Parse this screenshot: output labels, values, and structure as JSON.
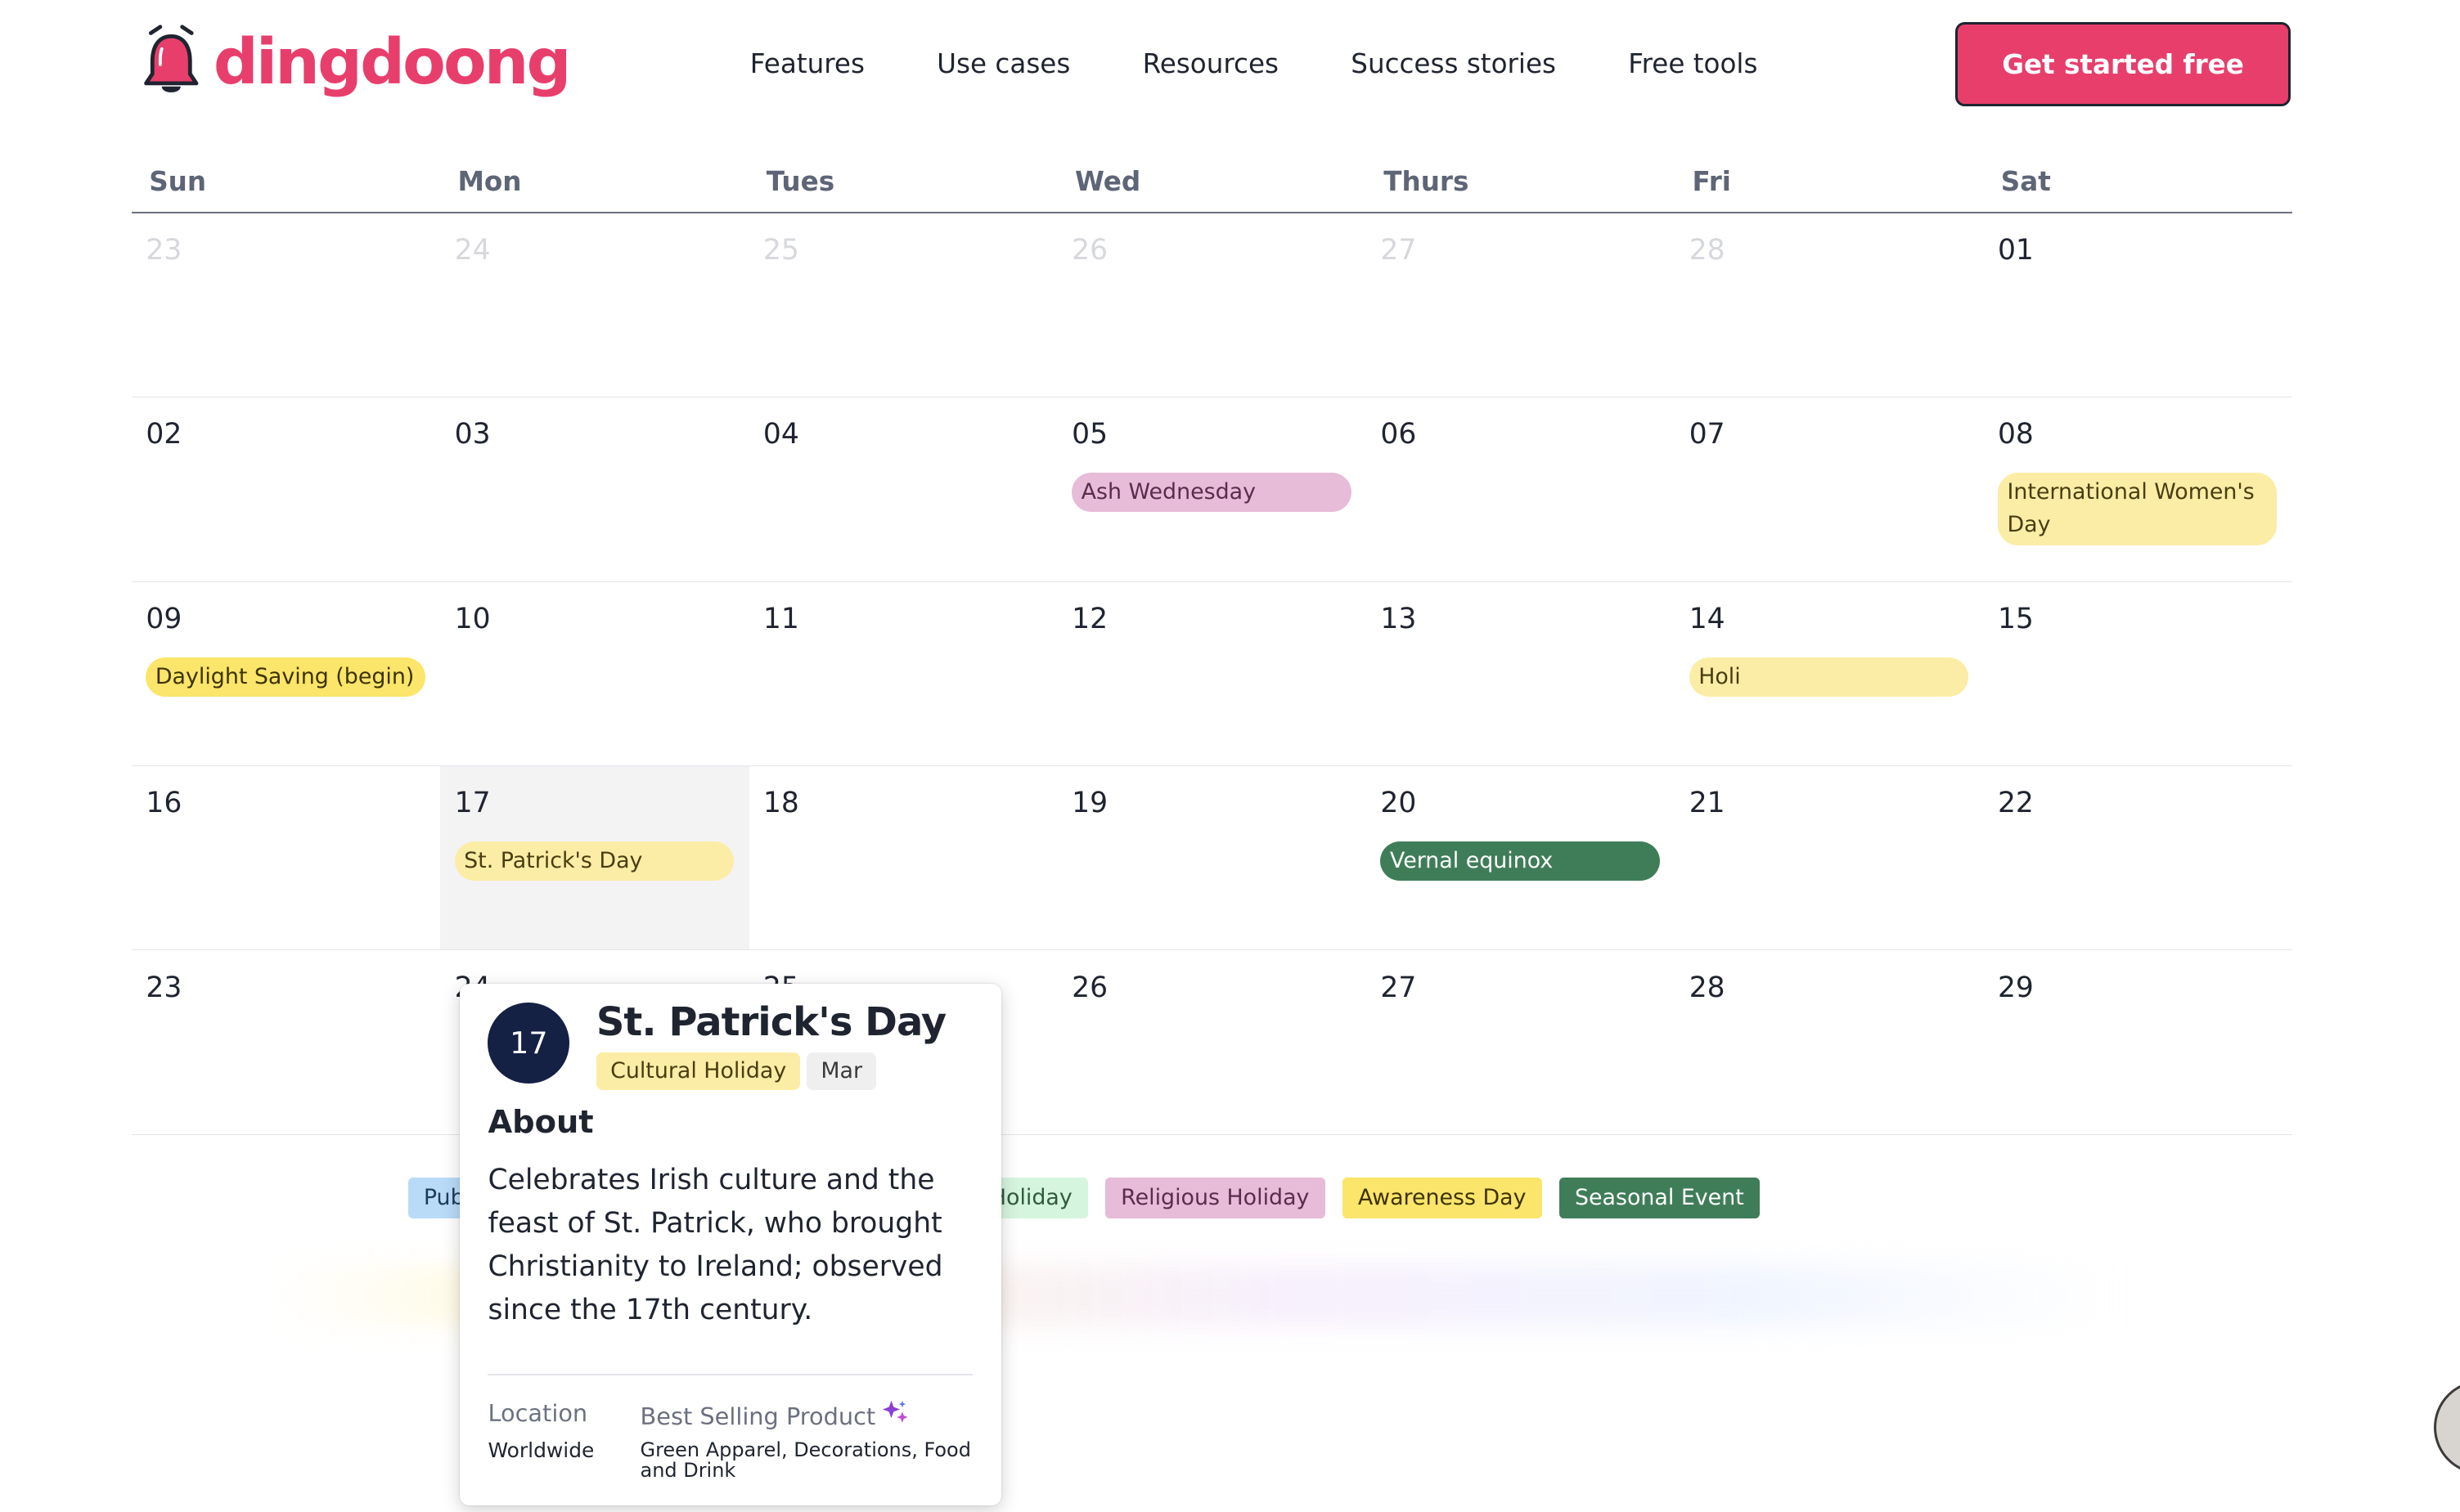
{
  "brand": {
    "name": "dingdoong",
    "color": "#e83e6c"
  },
  "nav": {
    "items": [
      "Features",
      "Use cases",
      "Resources",
      "Success stories",
      "Free tools"
    ],
    "cta_label": "Get started free"
  },
  "calendar": {
    "weekdays": [
      "Sun",
      "Mon",
      "Tues",
      "Wed",
      "Thurs",
      "Fri",
      "Sat"
    ],
    "weeks": [
      [
        {
          "num": "23",
          "muted": true
        },
        {
          "num": "24",
          "muted": true
        },
        {
          "num": "25",
          "muted": true
        },
        {
          "num": "26",
          "muted": true
        },
        {
          "num": "27",
          "muted": true
        },
        {
          "num": "28",
          "muted": true
        },
        {
          "num": "01"
        }
      ],
      [
        {
          "num": "02"
        },
        {
          "num": "03"
        },
        {
          "num": "04"
        },
        {
          "num": "05",
          "event": {
            "label": "Ash Wednesday",
            "type": "religious"
          }
        },
        {
          "num": "06"
        },
        {
          "num": "07"
        },
        {
          "num": "08",
          "event": {
            "label": "International Women's Day",
            "type": "cultural"
          }
        }
      ],
      [
        {
          "num": "09",
          "event": {
            "label": "Daylight Saving (begin)",
            "type": "awareness"
          }
        },
        {
          "num": "10"
        },
        {
          "num": "11"
        },
        {
          "num": "12"
        },
        {
          "num": "13"
        },
        {
          "num": "14",
          "event": {
            "label": "Holi",
            "type": "cultural"
          }
        },
        {
          "num": "15"
        }
      ],
      [
        {
          "num": "16"
        },
        {
          "num": "17",
          "highlight": true,
          "event": {
            "label": "St. Patrick's Day",
            "type": "cultural"
          }
        },
        {
          "num": "18"
        },
        {
          "num": "19"
        },
        {
          "num": "20",
          "event": {
            "label": "Vernal equinox",
            "type": "seasonal"
          }
        },
        {
          "num": "21"
        },
        {
          "num": "22"
        }
      ],
      [
        {
          "num": "23"
        },
        {
          "num": "24"
        },
        {
          "num": "25"
        },
        {
          "num": "26"
        },
        {
          "num": "27"
        },
        {
          "num": "28"
        },
        {
          "num": "29"
        }
      ]
    ]
  },
  "legend": [
    {
      "label": "Public Holiday",
      "type": "public"
    },
    {
      "label": "Cultural Holiday",
      "type": "cultural"
    },
    {
      "label": "Commercial Holiday",
      "type": "commercial"
    },
    {
      "label": "Religious Holiday",
      "type": "religious"
    },
    {
      "label": "Awareness Day",
      "type": "awareness"
    },
    {
      "label": "Seasonal Event",
      "type": "seasonal"
    }
  ],
  "event_colors": {
    "public": {
      "bg": "#b9dbf7",
      "fg": "#1f3b5c"
    },
    "cultural": {
      "bg": "#fbeda6",
      "fg": "#4a3d10"
    },
    "commercial": {
      "bg": "#d6f5df",
      "fg": "#2f5b3c"
    },
    "religious": {
      "bg": "#e6bcd8",
      "fg": "#5a2d4c"
    },
    "awareness": {
      "bg": "#fbe56a",
      "fg": "#3d3300"
    },
    "seasonal": {
      "bg": "#3f7d58",
      "fg": "#ffffff"
    }
  },
  "popover": {
    "day": "17",
    "title": "St. Patrick's Day",
    "tags": [
      "Cultural Holiday",
      "Mar"
    ],
    "about_heading": "About",
    "description": "Celebrates Irish culture and the feast of St. Patrick, who brought Christianity to Ireland; observed since the 17th century.",
    "location_label": "Location",
    "location_value": "Worldwide",
    "best_selling_label": "Best Selling Product",
    "best_selling_value": "Green Apparel, Decorations, Food and Drink"
  }
}
